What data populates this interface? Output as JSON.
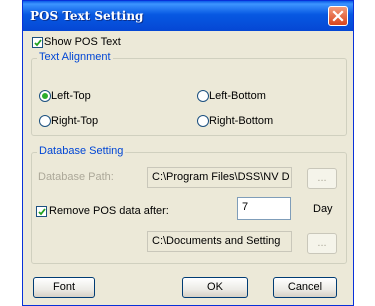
{
  "window": {
    "title": "POS Text Setting"
  },
  "show_pos_text": {
    "label": "Show POS Text",
    "checked": true
  },
  "text_alignment": {
    "group_label": "Text Alignment",
    "options": [
      {
        "label": "Left-Top",
        "selected": true
      },
      {
        "label": "Left-Bottom",
        "selected": false
      },
      {
        "label": "Right-Top",
        "selected": false
      },
      {
        "label": "Right-Bottom",
        "selected": false
      }
    ]
  },
  "database_setting": {
    "group_label": "Database Setting",
    "path_label": "Database Path:",
    "path_value": "C:\\Program Files\\DSS\\NV D",
    "browse_label": "...",
    "remove_label": "Remove POS data after:",
    "remove_checked": true,
    "days_value": "7",
    "days_unit": "Day",
    "second_path_value": "C:\\Documents and Setting",
    "second_browse_label": "..."
  },
  "buttons": {
    "font": "Font",
    "ok": "OK",
    "cancel": "Cancel"
  },
  "colors": {
    "title_bar": "#0758e2",
    "group_title": "#0046d5",
    "dialog_face": "#ece9d8",
    "check_mark": "#21a121",
    "radio_dot": "#2dad2d",
    "close_button": "#d9441c"
  },
  "icons": {
    "close": "close-x-icon",
    "check": "check-icon"
  }
}
